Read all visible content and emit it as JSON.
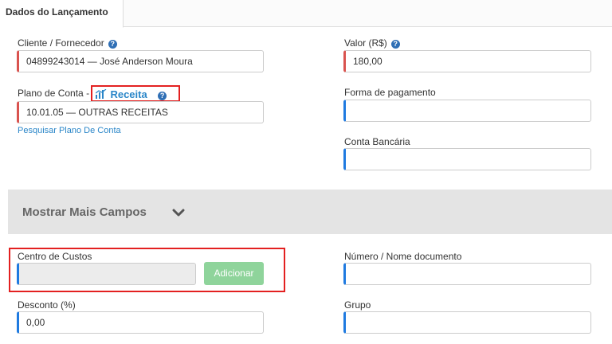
{
  "tab": {
    "label": "Dados do Lançamento"
  },
  "cliente": {
    "label": "Cliente / Fornecedor",
    "value": "04899243014 — José Anderson Moura"
  },
  "valor": {
    "label": "Valor (R$)",
    "value": "180,00"
  },
  "plano": {
    "label": "Plano de Conta - ",
    "tipo": "Receita",
    "value": "10.01.05 — OUTRAS RECEITAS",
    "search_link": "Pesquisar Plano De Conta"
  },
  "forma_pagamento": {
    "label": "Forma de pagamento",
    "value": ""
  },
  "conta_bancaria": {
    "label": "Conta Bancária",
    "value": ""
  },
  "more": {
    "label": "Mostrar Mais Campos"
  },
  "centro_custos": {
    "label": "Centro de Custos",
    "value": "",
    "button_label": "Adicionar"
  },
  "numero_documento": {
    "label": "Número / Nome documento",
    "value": ""
  },
  "desconto": {
    "label": "Desconto (%)",
    "value": "0,00"
  },
  "grupo": {
    "label": "Grupo",
    "value": ""
  },
  "icons": {
    "help": "?"
  },
  "colors": {
    "accent": "#2a86c8",
    "required_bar": "#d9534f",
    "field_bar": "#1f7ae0",
    "highlight": "#e32020",
    "add_button": "#8fd49b"
  }
}
